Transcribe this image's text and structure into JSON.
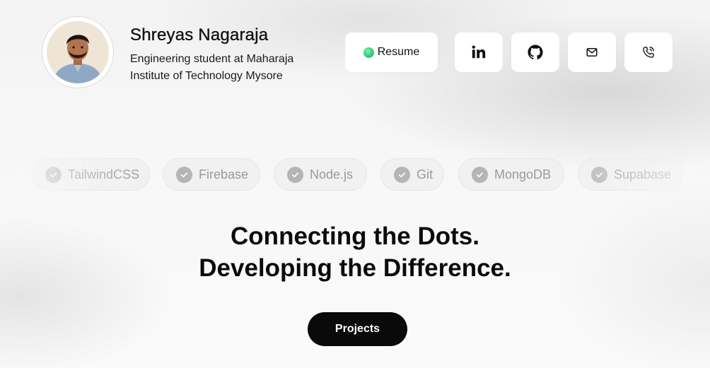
{
  "profile": {
    "name": "Shreyas Nagaraja",
    "tagline": "Engineering student at Maharaja Institute of Technology Mysore"
  },
  "actions": {
    "resume_label": "Resume",
    "linkedin_icon": "linkedin-icon",
    "github_icon": "github-icon",
    "mail_icon": "mail-icon",
    "phone_icon": "phone-icon"
  },
  "skills": [
    "TailwindCSS",
    "Firebase",
    "Node.js",
    "Git",
    "MongoDB",
    "Supabase"
  ],
  "hero": {
    "line1": "Connecting the Dots.",
    "line2": "Developing the Difference."
  },
  "cta": {
    "projects_label": "Projects"
  },
  "colors": {
    "accent_dot": "#2ecf7e",
    "cta_background": "#0a0a0a"
  }
}
